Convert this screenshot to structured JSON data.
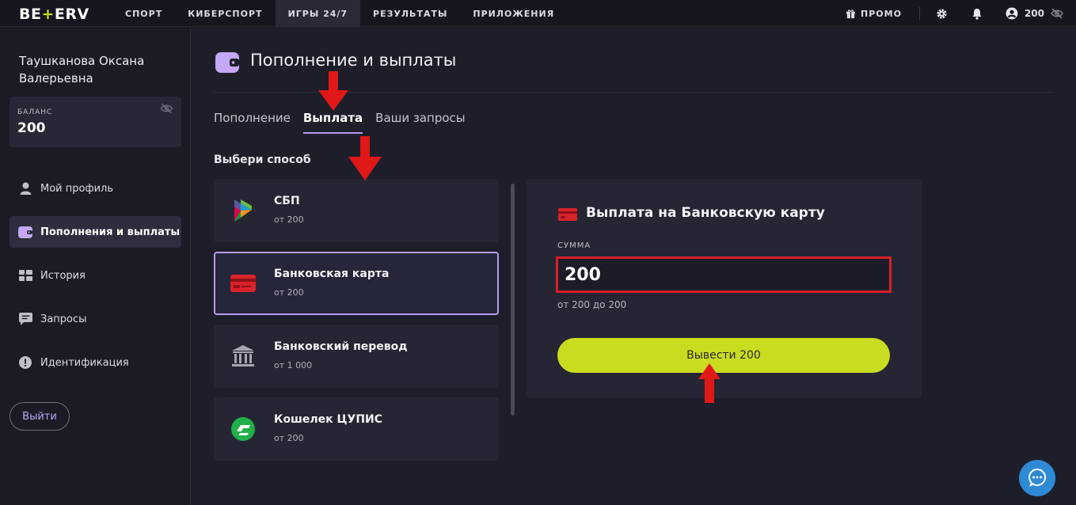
{
  "topbar": {
    "logo_left": "BE",
    "logo_plus": "+",
    "logo_right": "ERV",
    "nav": [
      "СПОРТ",
      "КИБЕРСПОРТ",
      "ИГРЫ 24/7",
      "РЕЗУЛЬТАТЫ",
      "ПРИЛОЖЕНИЯ"
    ],
    "active_nav": "ИГРЫ 24/7",
    "promo": "ПРОМО",
    "balance": "200",
    "icons": [
      "gift-icon",
      "gear-icon",
      "bell-icon",
      "user-circle-icon",
      "eye-off-icon"
    ]
  },
  "sidebar": {
    "user_name": "Таушканова Оксана Валерьевна",
    "balance_label": "БАЛАНС",
    "balance_value": "200",
    "items": [
      {
        "label": "Мой профиль",
        "icon": "user-icon"
      },
      {
        "label": "Пополнения и выплаты",
        "icon": "wallet-icon",
        "active": true
      },
      {
        "label": "История",
        "icon": "history-icon"
      },
      {
        "label": "Запросы",
        "icon": "chat-icon"
      },
      {
        "label": "Идентификация",
        "icon": "alert-icon"
      }
    ],
    "logout": "Выйти"
  },
  "main": {
    "title": "Пополнение и выплаты",
    "tabs": [
      "Пополнение",
      "Выплата",
      "Ваши запросы"
    ],
    "active_tab": "Выплата",
    "choose_label": "Выбери способ",
    "methods": [
      {
        "title": "СБП",
        "sub": "от 200",
        "icon": "sbp-icon"
      },
      {
        "title": "Банковская карта",
        "sub": "от 200",
        "icon": "bank-card-icon",
        "selected": true
      },
      {
        "title": "Банковский перевод",
        "sub": "от 1 000",
        "icon": "bank-building-icon"
      },
      {
        "title": "Кошелек ЦУПИС",
        "sub": "от 200",
        "icon": "cupis-wallet-icon"
      }
    ],
    "panel": {
      "title": "Выплата на Банковскую карту",
      "sum_label": "СУММА",
      "sum_value": "200",
      "range": "от 200 до 200",
      "button": "Вывести 200"
    }
  },
  "colors": {
    "accent": "#b69cf2",
    "button": "#c9dc1f",
    "highlight": "#d8202a",
    "background": "#1e1e2a"
  }
}
